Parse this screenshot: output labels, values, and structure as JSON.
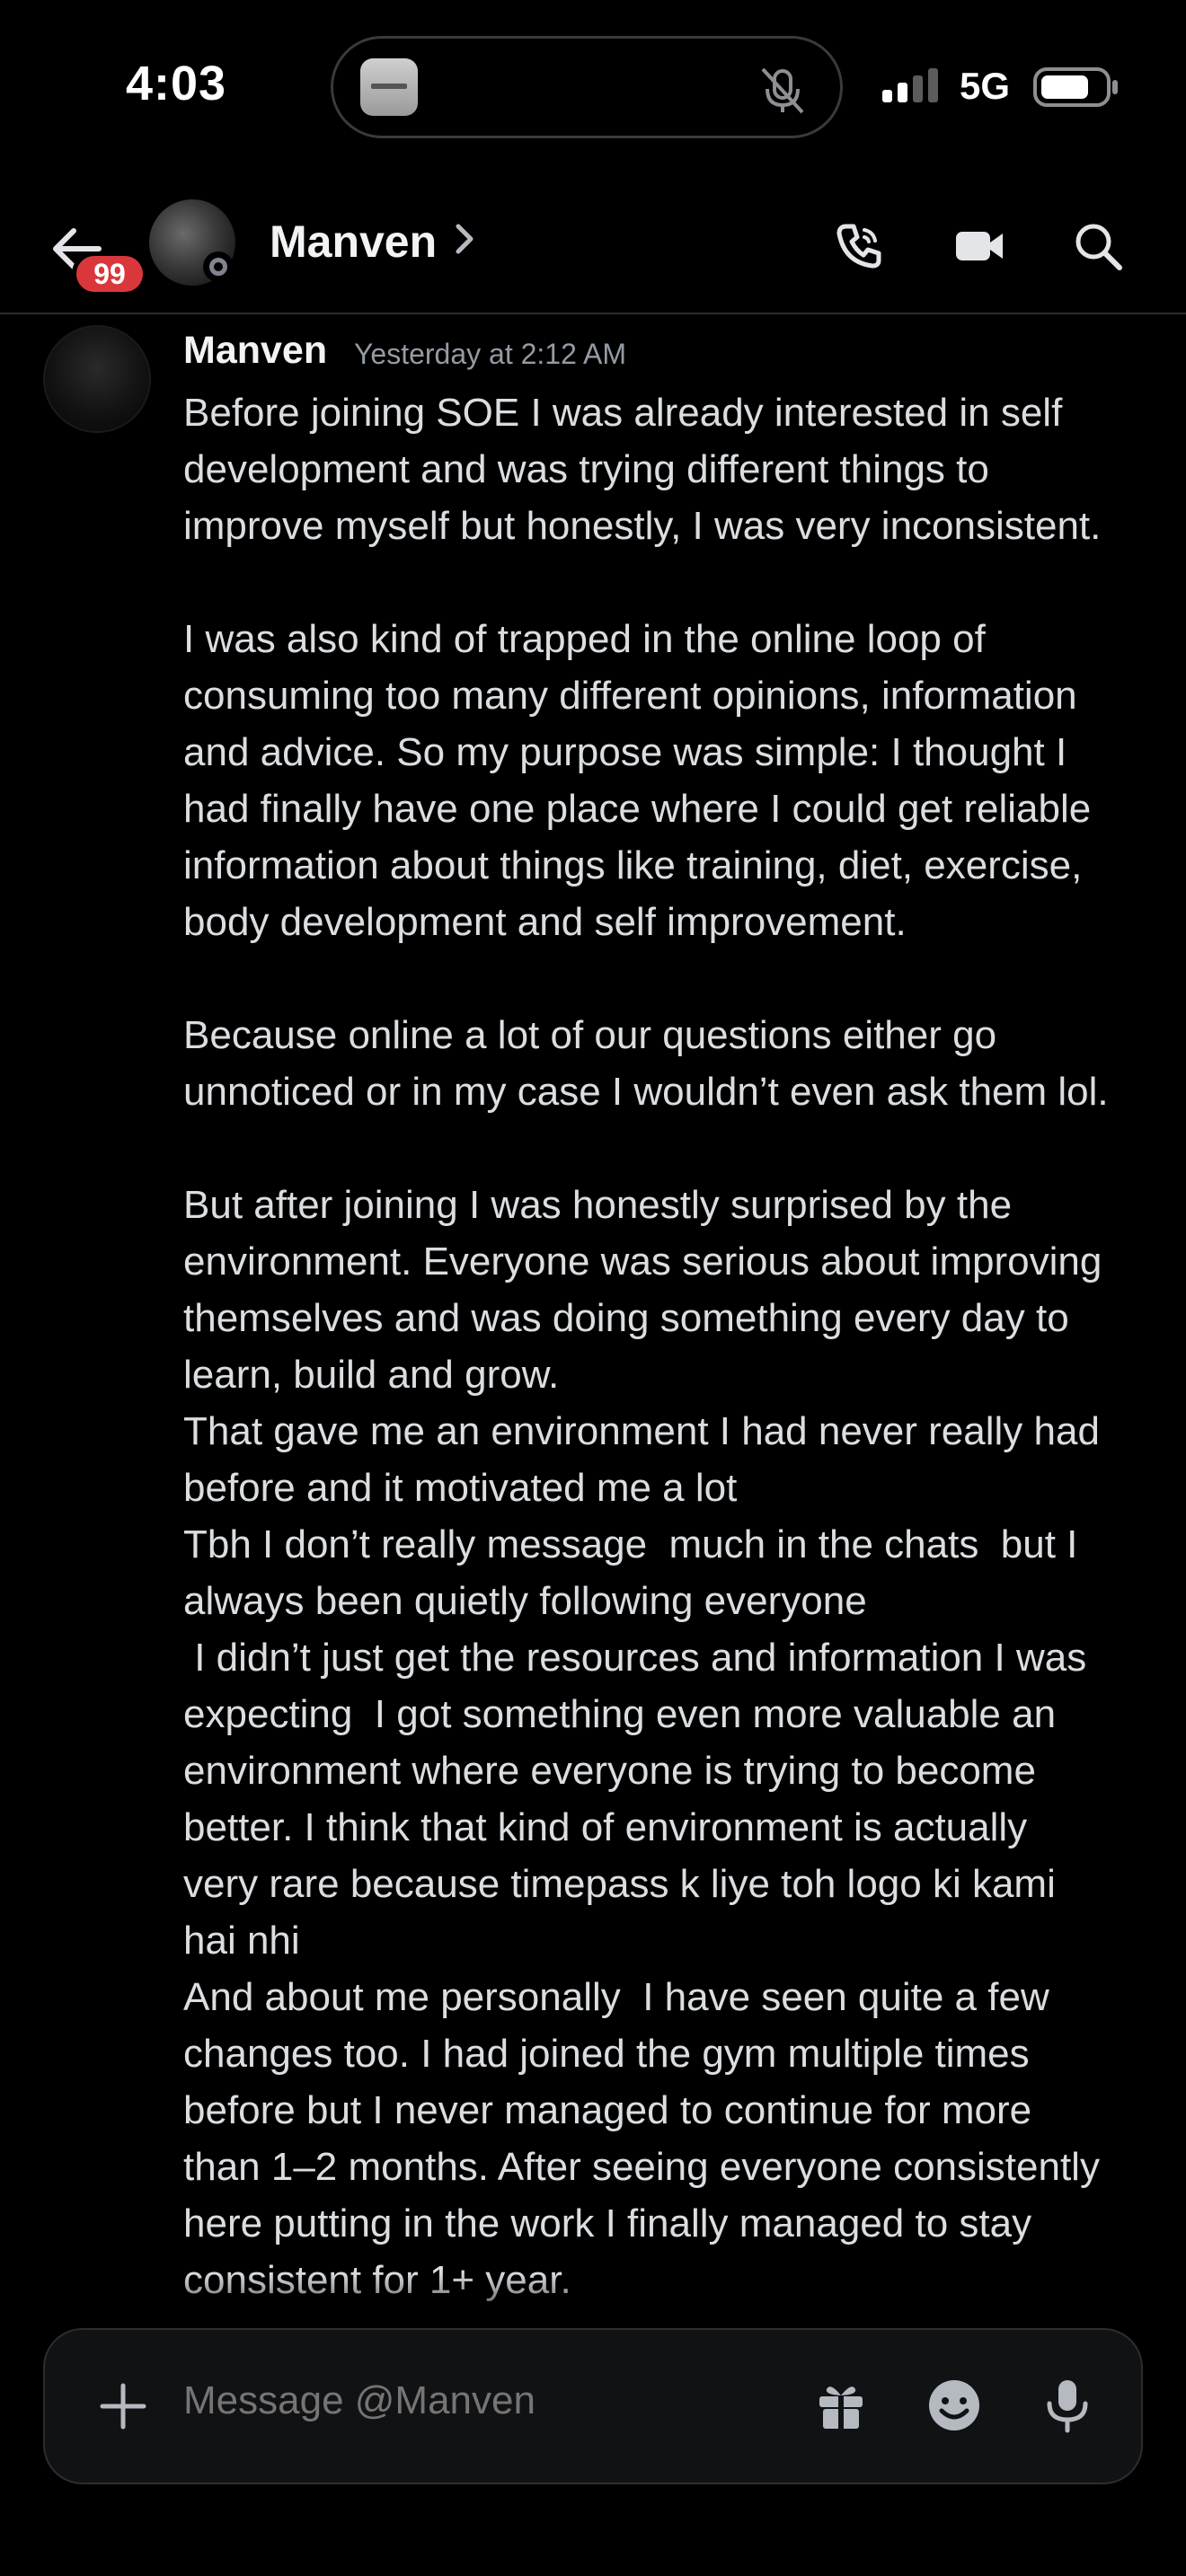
{
  "status_bar": {
    "time": "4:03",
    "network": "5G",
    "icons": [
      "app-thumbnail-icon",
      "mic-off-icon",
      "signal-icon",
      "battery-icon"
    ]
  },
  "header": {
    "unread_count": "99",
    "title": "Manven",
    "icons": [
      "back-arrow-icon",
      "chevron-right-icon",
      "phone-icon",
      "video-camera-icon",
      "search-icon"
    ]
  },
  "message": {
    "author": "Manven",
    "timestamp": "Yesterday at 2:12 AM",
    "lines": [
      "Before joining SOE I was already interested in self",
      "development and was trying different things to",
      "improve myself but honestly, I was very inconsistent.",
      "",
      "I was also kind of trapped in the online loop of",
      "consuming too many different opinions, information",
      "and advice. So my purpose was simple: I thought I",
      "had finally have one place where I could get reliable",
      "information about things like training, diet, exercise,",
      "body development and self improvement.",
      "",
      "Because online a lot of our questions either go",
      "unnoticed or in my case I wouldn’t even ask them lol.",
      "",
      "But after joining I was honestly surprised by the",
      "environment. Everyone was serious about improving",
      "themselves and was doing something every day to",
      "learn, build and grow.",
      "That gave me an environment I had never really had",
      "before and it motivated me a lot",
      "Tbh I don’t really message  much in the chats  but I",
      "always been quietly following everyone",
      " I didn’t just get the resources and information I was",
      "expecting  I got something even more valuable an",
      "environment where everyone is trying to become",
      "better. I think that kind of environment is actually",
      "very rare because timepass k liye toh logo ki kami",
      "hai nhi",
      "And about me personally  I have seen quite a few",
      "changes too. I had joined the gym multiple times",
      "before but I never managed to continue for more",
      "than 1–2 months. After seeing everyone consistently",
      "here putting in the work I finally managed to stay",
      "consistent for 1+ year."
    ]
  },
  "composer": {
    "placeholder": "Message @Manven",
    "icons": [
      "plus-icon",
      "gift-icon",
      "emoji-icon",
      "microphone-icon"
    ]
  },
  "colors": {
    "background": "#000000",
    "text": "#dbdee1",
    "muted": "#949ba4",
    "badge": "#da373c"
  }
}
